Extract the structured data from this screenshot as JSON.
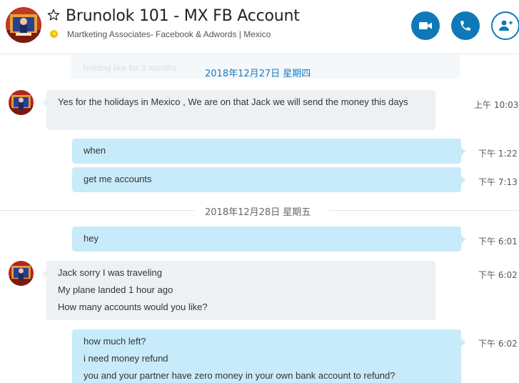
{
  "header": {
    "title": "Brunolok 101 - MX FB Account",
    "subtitle": "Martketing Associates- Facebook & Adwords  |  Mexico",
    "accent": "#0f78b8",
    "status_color": "#f2c200"
  },
  "ghost_preview": "holding like for 3 months",
  "chat": {
    "date1": "2018年12月27日 星期四",
    "date2": "2018年12月28日 星期五",
    "messages": [
      {
        "dir": "in",
        "lines": [
          " Yes for the holidays in Mexico , We are on that Jack we will send the money this days"
        ],
        "time": "上午 10:03"
      },
      {
        "dir": "out",
        "lines": [
          "when"
        ],
        "time": "下午 1:22"
      },
      {
        "dir": "out",
        "lines": [
          "get me accounts"
        ],
        "time": "下午 7:13"
      },
      {
        "dir": "out",
        "lines": [
          "hey"
        ],
        "time": "下午 6:01"
      },
      {
        "dir": "in",
        "lines": [
          " Jack sorry I was traveling",
          "My plane landed 1 hour ago",
          "How many accounts would you like?"
        ],
        "time": "下午 6:02"
      },
      {
        "dir": "out",
        "lines": [
          "how much left?",
          "i need money refund",
          "you and your partner have zero money in your own bank account to refund?"
        ],
        "time": "下午 6:02"
      }
    ]
  }
}
